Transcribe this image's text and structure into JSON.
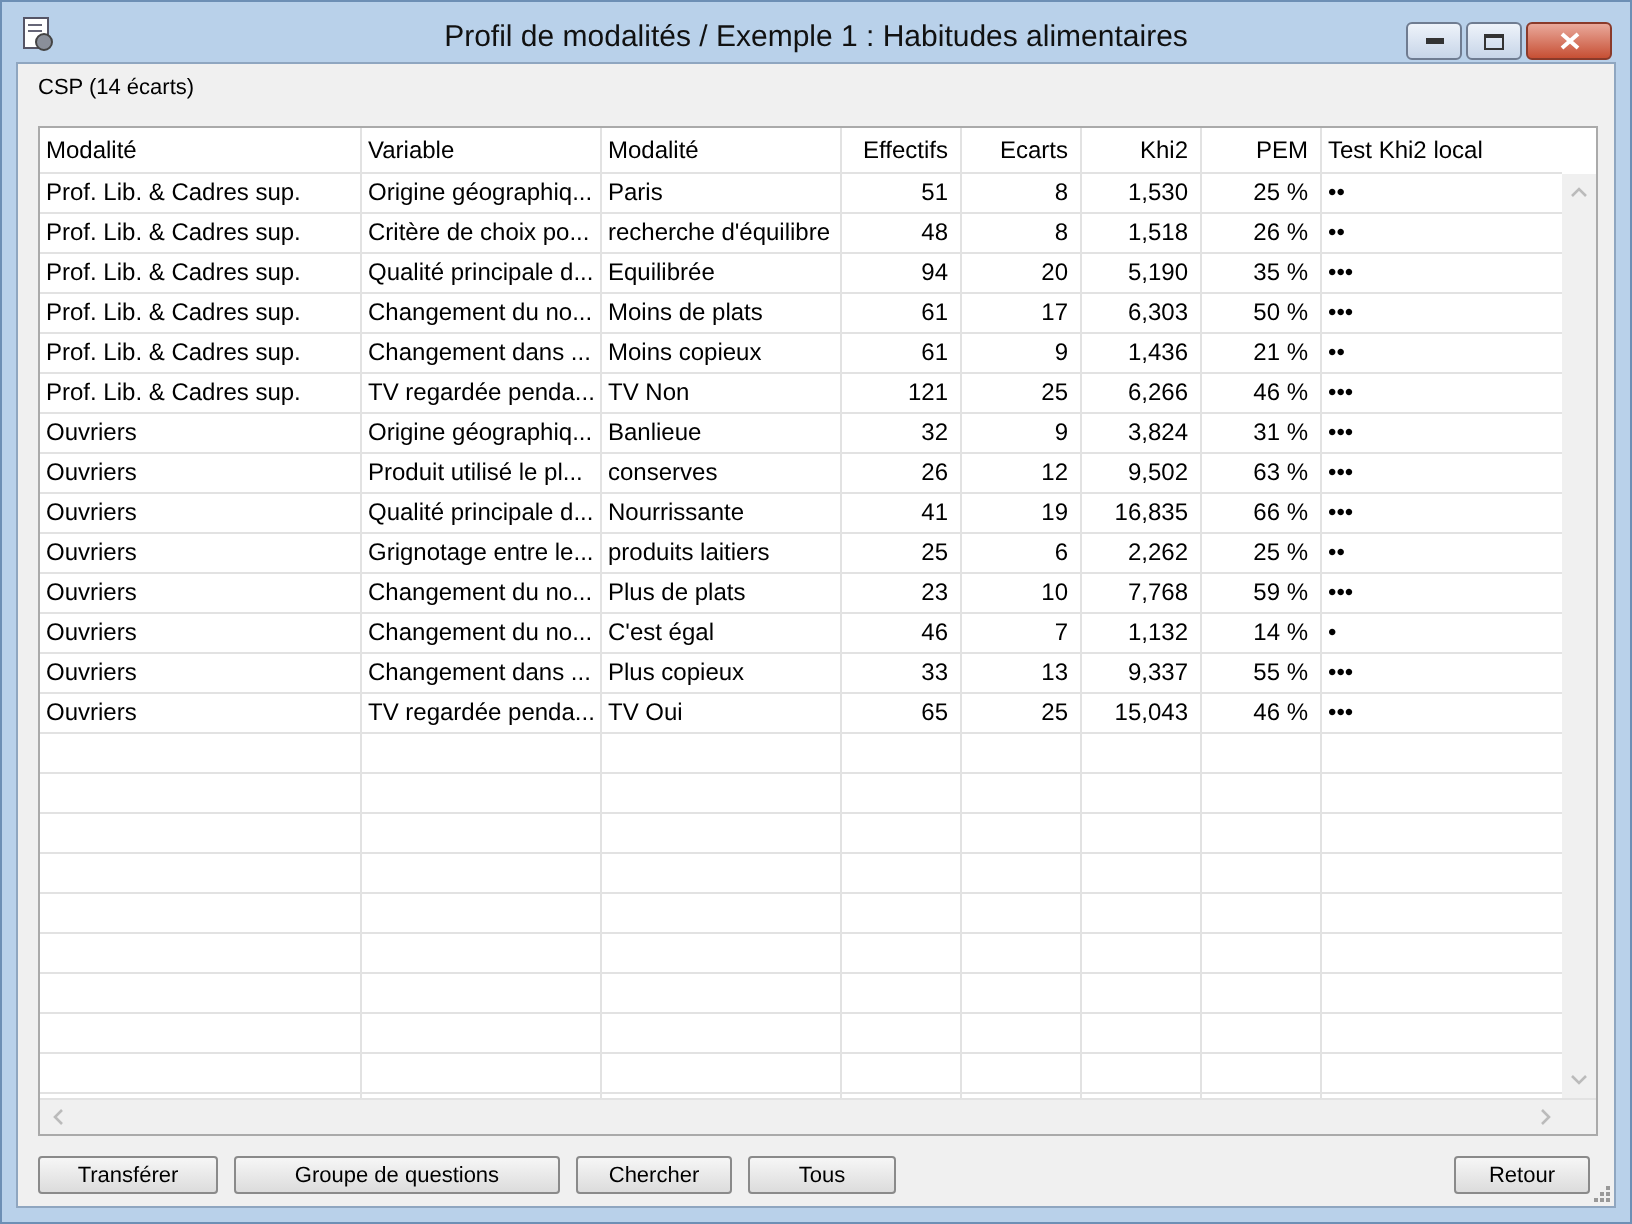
{
  "window": {
    "title": "Profil de modalités / Exemple 1 : Habitudes alimentaires"
  },
  "group_label": "CSP (14 écarts)",
  "table": {
    "columns": [
      "Modalité",
      "Variable",
      "Modalité",
      "Effectifs",
      "Ecarts",
      "Khi2",
      "PEM",
      "Test Khi2 local"
    ],
    "rows": [
      [
        "Prof. Lib. & Cadres sup.",
        "Origine géographiq...",
        "Paris",
        "51",
        "8",
        "1,530",
        "25 %",
        "••"
      ],
      [
        "Prof. Lib. & Cadres sup.",
        "Critère de choix po...",
        "recherche d'équilibre",
        "48",
        "8",
        "1,518",
        "26 %",
        "••"
      ],
      [
        "Prof. Lib. & Cadres sup.",
        "Qualité principale d...",
        "Equilibrée",
        "94",
        "20",
        "5,190",
        "35 %",
        "•••"
      ],
      [
        "Prof. Lib. & Cadres sup.",
        "Changement du no...",
        "Moins de plats",
        "61",
        "17",
        "6,303",
        "50 %",
        "•••"
      ],
      [
        "Prof. Lib. & Cadres sup.",
        "Changement dans ...",
        "Moins copieux",
        "61",
        "9",
        "1,436",
        "21 %",
        "••"
      ],
      [
        "Prof. Lib. & Cadres sup.",
        "TV regardée penda...",
        "TV Non",
        "121",
        "25",
        "6,266",
        "46 %",
        "•••"
      ],
      [
        "Ouvriers",
        "Origine géographiq...",
        "Banlieue",
        "32",
        "9",
        "3,824",
        "31 %",
        "•••"
      ],
      [
        "Ouvriers",
        "Produit utilisé le pl...",
        "conserves",
        "26",
        "12",
        "9,502",
        "63 %",
        "•••"
      ],
      [
        "Ouvriers",
        "Qualité principale d...",
        "Nourrissante",
        "41",
        "19",
        "16,835",
        "66 %",
        "•••"
      ],
      [
        "Ouvriers",
        "Grignotage entre le...",
        "produits laitiers",
        "25",
        "6",
        "2,262",
        "25 %",
        "••"
      ],
      [
        "Ouvriers",
        "Changement du no...",
        "Plus de plats",
        "23",
        "10",
        "7,768",
        "59 %",
        "•••"
      ],
      [
        "Ouvriers",
        "Changement du no...",
        "C'est égal",
        "46",
        "7",
        "1,132",
        "14 %",
        "•"
      ],
      [
        "Ouvriers",
        "Changement dans ...",
        "Plus copieux",
        "33",
        "13",
        "9,337",
        "55 %",
        "•••"
      ],
      [
        "Ouvriers",
        "TV regardée penda...",
        "TV Oui",
        "65",
        "25",
        "15,043",
        "46 %",
        "•••"
      ]
    ]
  },
  "buttons_left": [
    "Transférer",
    "Groupe de questions",
    "Chercher",
    "Tous"
  ],
  "buttons_right": [
    "Retour"
  ]
}
